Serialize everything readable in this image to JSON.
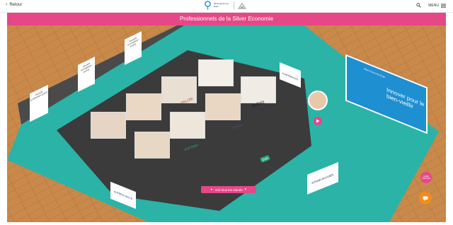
{
  "header": {
    "back_label": "Retour",
    "logo_text": "Silver Economy Expo",
    "menu_label": "MENU"
  },
  "banner": {
    "title": "Professionnels de la Silver Economie"
  },
  "signs": {
    "brand": "SILVER ECONOMY EXPO",
    "conferences": "CONFÉRENCES",
    "autres_halls": "AUTRES HALLS",
    "stand_accueil": "STAND ACCUEIL",
    "billboard": "Innover pour le bien-vieillir",
    "billboard_brand": "Silver Economy Expo"
  },
  "booths": [
    "LYDIA",
    "",
    "",
    "VALLEE",
    "",
    "",
    "ardoiz",
    "",
    "AXFORD",
    "Nostrum",
    "Qwik"
  ],
  "buttons": {
    "cta": "Voir tous les stands",
    "guide": "GUIDE VISITEUR"
  },
  "colors": {
    "accent": "#e64787",
    "floor_teal": "#2bb3a8",
    "center_dark": "#3b3b3b",
    "wood": "#c8894b",
    "orange": "#f28c1a"
  }
}
